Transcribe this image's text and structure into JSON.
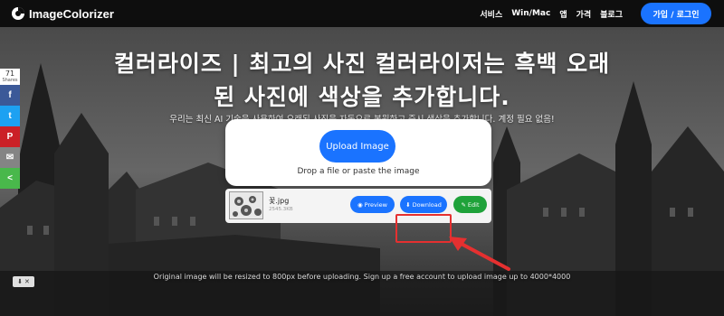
{
  "header": {
    "brand": "ImageColorizer",
    "nav": [
      "서비스",
      "Win/Mac",
      "앱",
      "가격",
      "블로그"
    ],
    "signup_label": "가입 / 로그인"
  },
  "hero": {
    "title": "컬러라이즈 | 최고의 사진 컬러라이저는 흑백 오래된 사진에 색상을 추가합니다.",
    "subtitle": "우리는 최신 AI 기술을 사용하여 오래된 사진을 자동으로 복원하고 즉시 색상을 추가합니다. 계정 필요 없음!"
  },
  "share": {
    "count": "71",
    "count_label": "Shares",
    "buttons": [
      {
        "name": "facebook",
        "glyph": "f",
        "color": "#3b5998"
      },
      {
        "name": "twitter",
        "glyph": "t",
        "color": "#1da1f2"
      },
      {
        "name": "pinterest",
        "glyph": "P",
        "color": "#cb2027"
      },
      {
        "name": "email",
        "glyph": "✉",
        "color": "#848484"
      },
      {
        "name": "sharethis",
        "glyph": "<",
        "color": "#49b84b"
      }
    ]
  },
  "upload": {
    "button_label": "Upload Image",
    "drop_text": "Drop a file or paste the image"
  },
  "file": {
    "name": "꽃.jpg",
    "size": "2545.3KB",
    "preview_label": "Preview",
    "download_label": "Download",
    "edit_label": "Edit"
  },
  "note": "Original image will be resized to 800px before uploading. Sign up a free account to upload image up to 4000*4000",
  "colors": {
    "accent": "#1a73ff",
    "edit": "#1fa23a",
    "highlight": "#e53030"
  }
}
